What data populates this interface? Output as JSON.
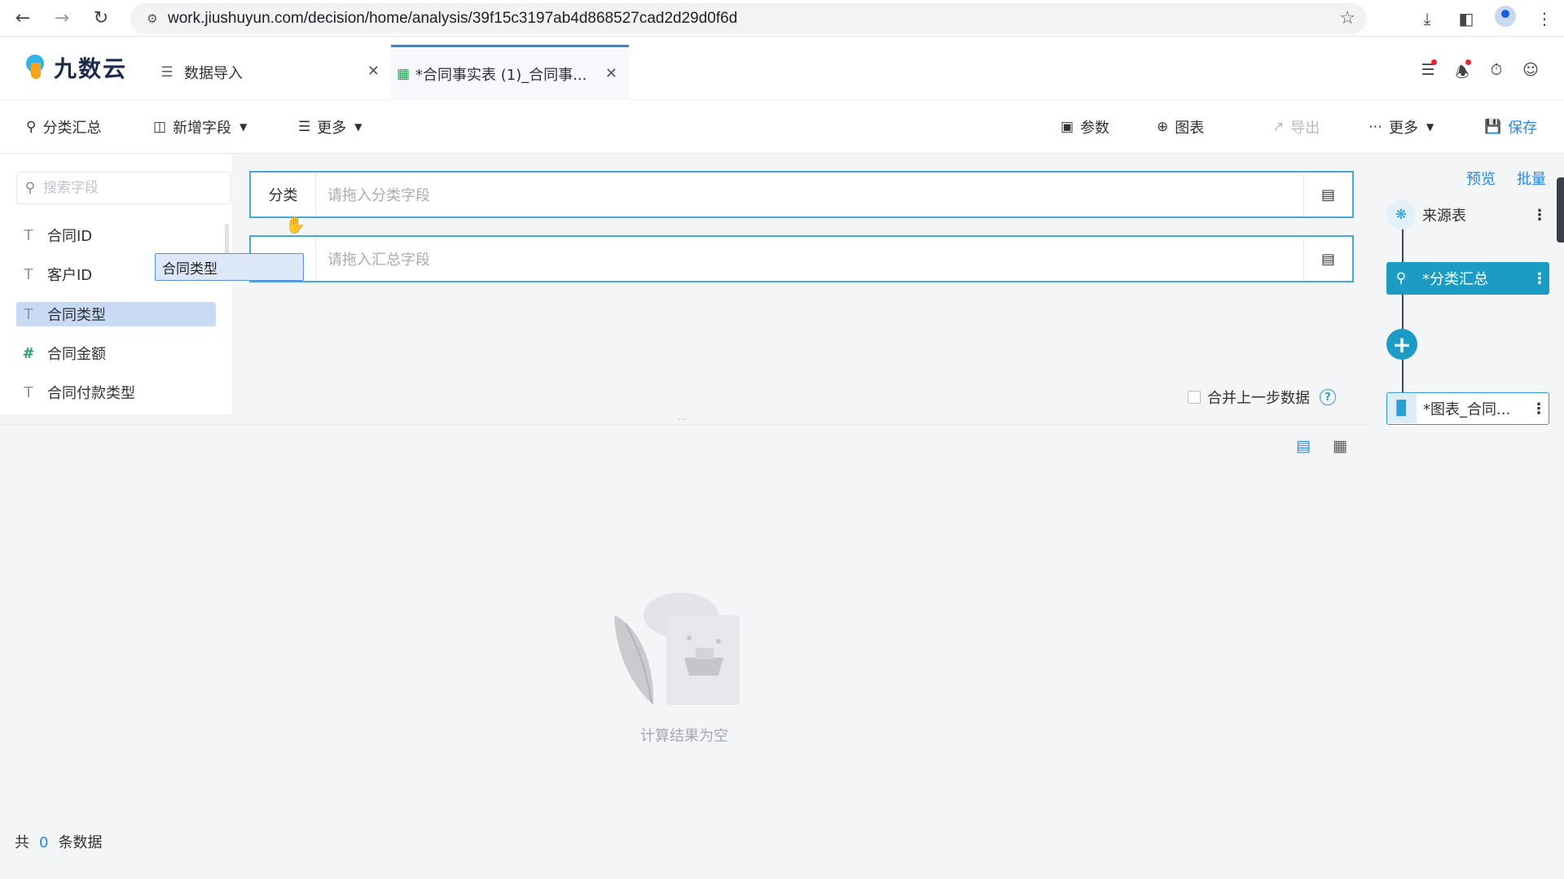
{
  "browser": {
    "url": "work.jiushuyun.com/decision/home/analysis/39f15c3197ab4d868527cad2d29d0f6d"
  },
  "app": {
    "logo_text": "九数云",
    "tabs": [
      {
        "label": "数据导入",
        "icon": "database-import-icon"
      },
      {
        "label": "*合同事实表 (1)_合同事...",
        "icon": "sheet-icon"
      }
    ]
  },
  "toolbar": {
    "group_label": "分类汇总",
    "add_field_label": "新增字段",
    "more_left_label": "更多",
    "params_label": "参数",
    "chart_label": "图表",
    "export_label": "导出",
    "more_right_label": "更多",
    "save_label": "保存"
  },
  "left_panel": {
    "search_placeholder": "搜索字段",
    "fields": [
      {
        "type": "T",
        "name": "合同ID"
      },
      {
        "type": "T",
        "name": "客户ID"
      },
      {
        "type": "T",
        "name": "合同类型"
      },
      {
        "type": "#",
        "name": "合同金额"
      },
      {
        "type": "T",
        "name": "合同付款类型"
      }
    ],
    "dragging_field": "合同类型"
  },
  "config": {
    "group_row_label": "分类",
    "group_row_placeholder": "请拖入分类字段",
    "summary_row_placeholder": "请拖入汇总字段",
    "merge_label": "合并上一步数据"
  },
  "result": {
    "empty_text": "计算结果为空",
    "footer_prefix": "共",
    "footer_count": "0",
    "footer_suffix": "条数据"
  },
  "flow": {
    "preview_label": "预览",
    "batch_label": "批量",
    "nodes": [
      {
        "label": "来源表"
      },
      {
        "label": "*分类汇总"
      },
      {
        "label": "*图表_合同..."
      }
    ]
  },
  "colors": {
    "accent": "#2e86de",
    "flow_active": "#1c9bc4",
    "border_active": "#45a8d8"
  }
}
